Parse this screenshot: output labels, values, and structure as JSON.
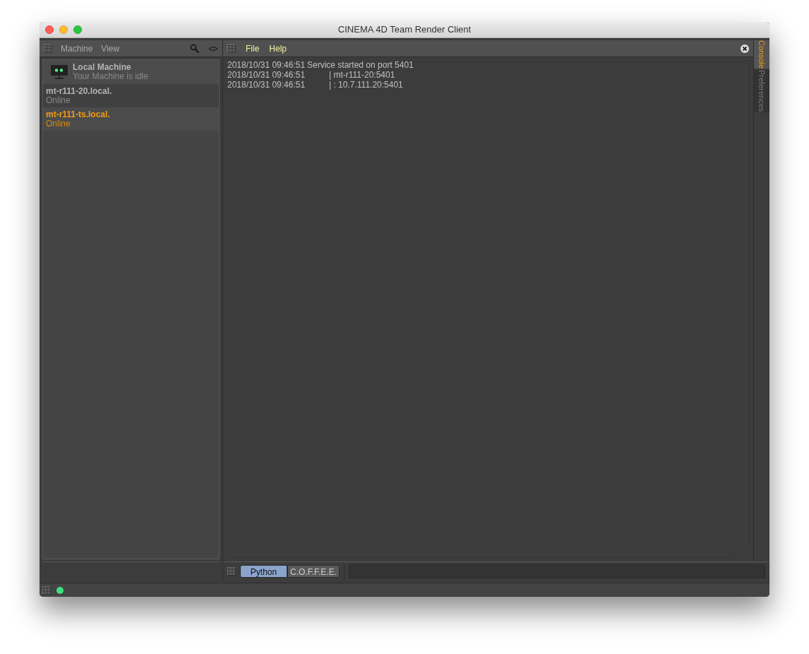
{
  "window": {
    "title": "CINEMA 4D Team Render Client"
  },
  "left_menu": [
    "Machine",
    "View"
  ],
  "machines": [
    {
      "kind": "local",
      "name": "Local Machine",
      "status": "Your Machine is idle",
      "selected": false
    },
    {
      "kind": "remote",
      "name": "mt-r111-20.local.",
      "status": "Online",
      "selected": false
    },
    {
      "kind": "remote",
      "name": "mt-r111-ts.local.",
      "status": "Online",
      "selected": true
    }
  ],
  "console_menu": [
    "File",
    "Help"
  ],
  "console_lines": [
    {
      "kind": "message",
      "time": "2018/10/31 09:46:51",
      "text": "Service started on port 5401"
    },
    {
      "kind": "continuation",
      "time": "2018/10/31 09:46:51",
      "text": "| mt-r111-20:5401"
    },
    {
      "kind": "continuation",
      "time": "2018/10/31 09:46:51",
      "text": "| : 10.7.111.20:5401"
    }
  ],
  "side_tabs": [
    {
      "label": "Console",
      "selected": true
    },
    {
      "label": "Preferences",
      "selected": false
    }
  ],
  "language_tabs": [
    {
      "label": "Python",
      "selected": true
    },
    {
      "label": "C.O.F.F.E.E.",
      "selected": false
    }
  ]
}
